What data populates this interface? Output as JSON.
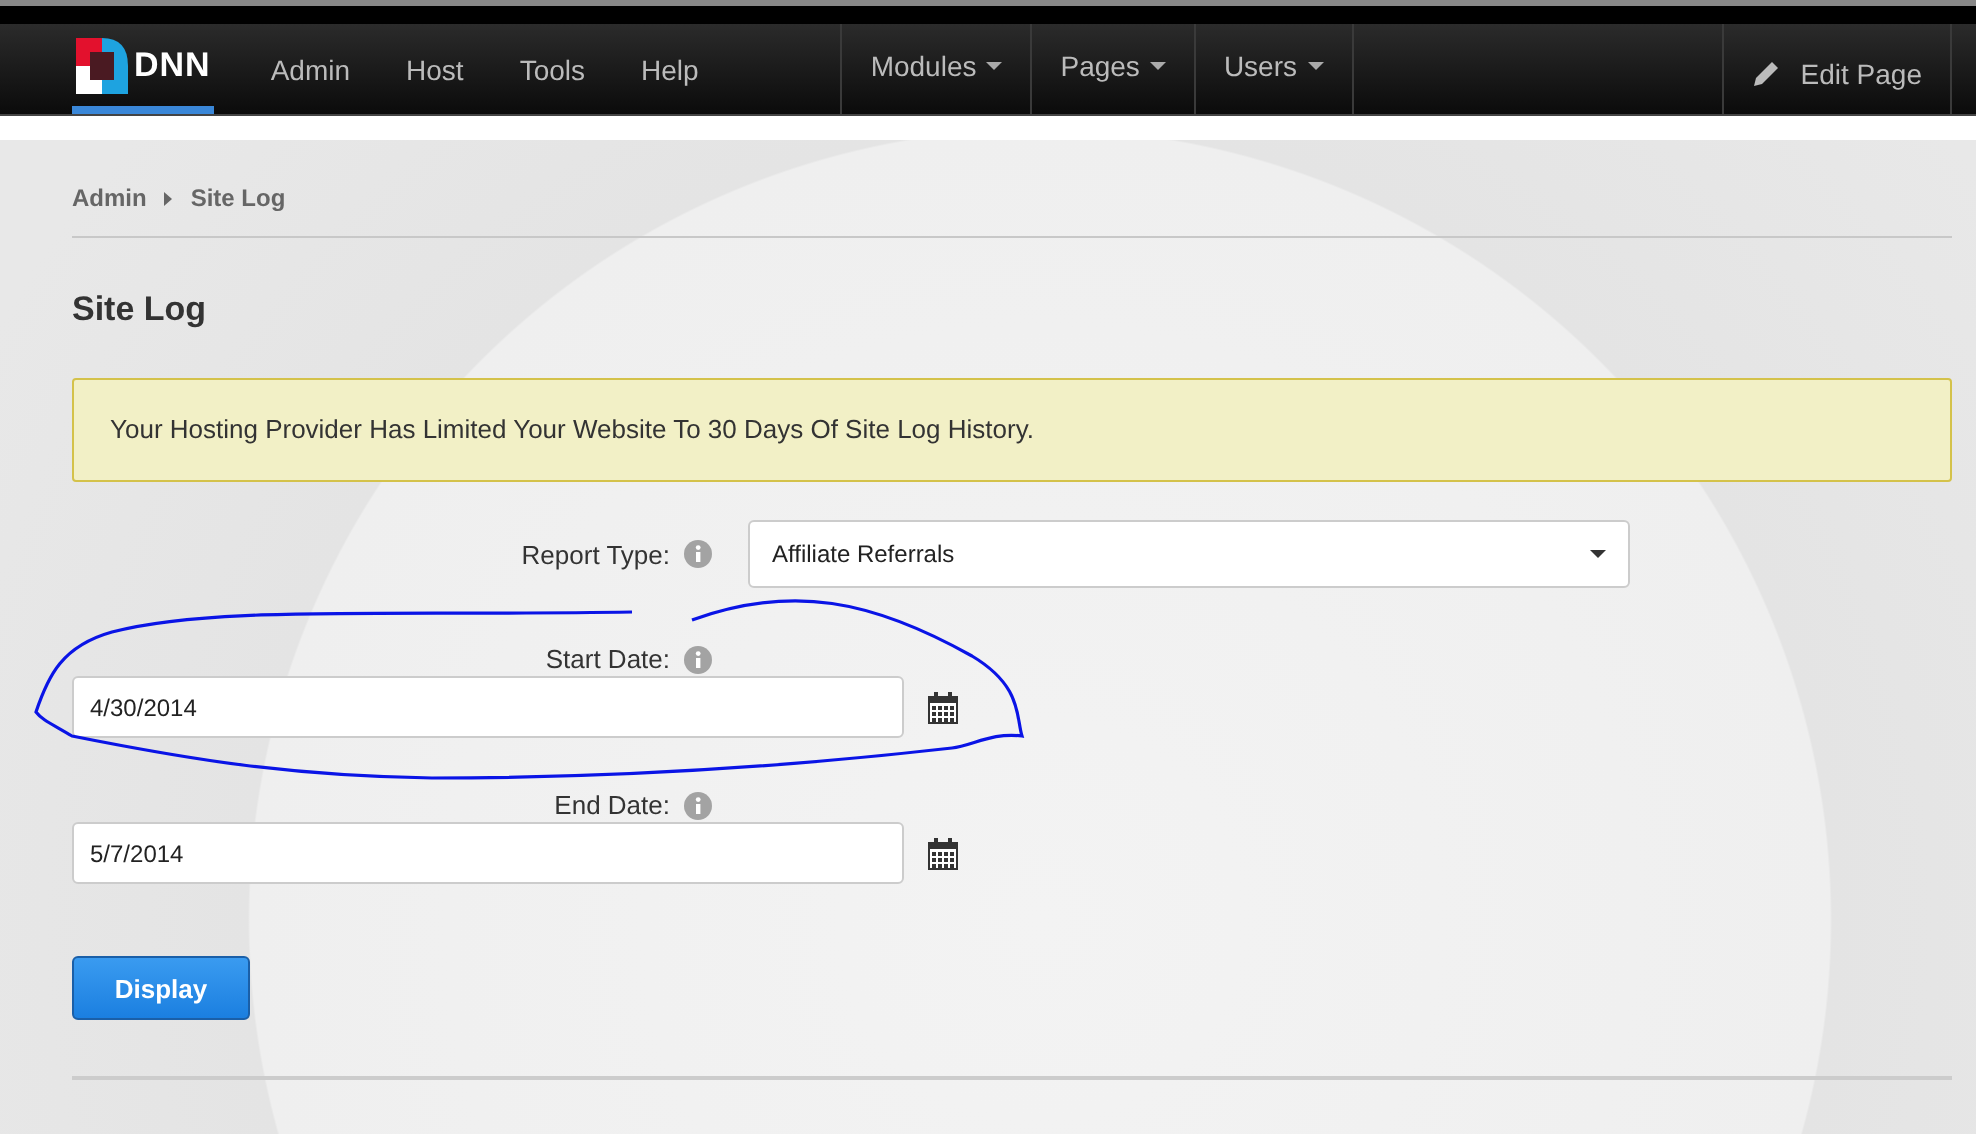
{
  "navbar": {
    "logo_text": "DNN",
    "links": [
      "Admin",
      "Host",
      "Tools",
      "Help"
    ],
    "menus": [
      "Modules",
      "Pages",
      "Users"
    ],
    "edit_page": "Edit Page"
  },
  "breadcrumb": [
    "Admin",
    "Site Log"
  ],
  "title": "Site Log",
  "alert": "Your Hosting Provider Has Limited Your Website To 30 Days Of Site Log History.",
  "fields": [
    {
      "kind": "select",
      "label": "Report Type:",
      "value": "Affiliate Referrals"
    },
    {
      "kind": "date",
      "label": "Start Date:",
      "value": "4/30/2014"
    },
    {
      "kind": "date",
      "label": "End Date:",
      "value": "5/7/2014"
    }
  ],
  "button": "Display"
}
